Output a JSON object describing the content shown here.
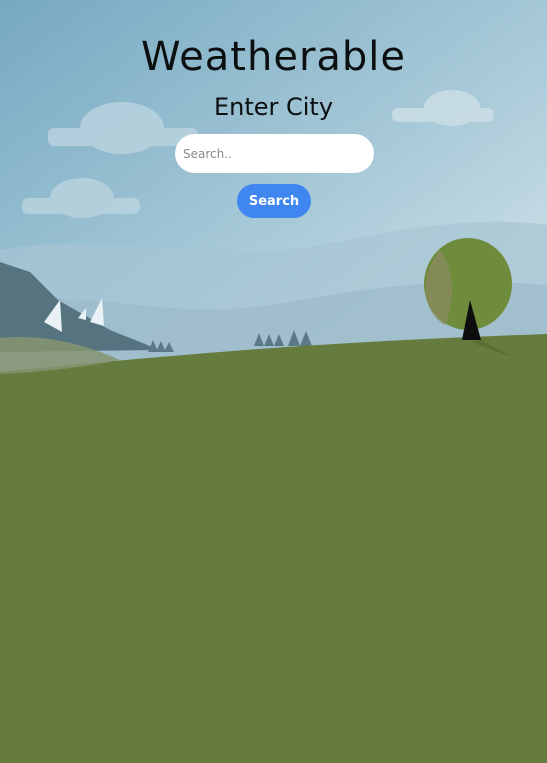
{
  "app": {
    "title": "Weatherable"
  },
  "search": {
    "label": "Enter City",
    "placeholder": "Search..",
    "value": "",
    "button_label": "Search"
  },
  "colors": {
    "sky_top": "#7fb0c8",
    "sky_bottom": "#d6e6ea",
    "grass": "#657c3e",
    "button": "#3f86f0",
    "tree": "#6f8c3c"
  }
}
